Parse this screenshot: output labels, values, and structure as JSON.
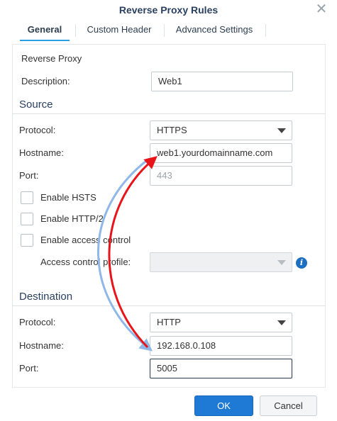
{
  "window": {
    "title": "Reverse Proxy Rules"
  },
  "tabs": [
    {
      "label": "General",
      "active": true
    },
    {
      "label": "Custom Header"
    },
    {
      "label": "Advanced Settings"
    }
  ],
  "general": {
    "heading": "Reverse Proxy",
    "description_label": "Description:",
    "description_value": "Web1"
  },
  "source": {
    "title": "Source",
    "protocol_label": "Protocol:",
    "protocol_value": "HTTPS",
    "hostname_label": "Hostname:",
    "hostname_value": "web1.yourdomainname.com",
    "port_label": "Port:",
    "port_value": "443",
    "hsts_label": "Enable HSTS",
    "http2_label": "Enable HTTP/2",
    "access_control_label": "Enable access control",
    "access_profile_label": "Access control profile:",
    "access_profile_value": ""
  },
  "destination": {
    "title": "Destination",
    "protocol_label": "Protocol:",
    "protocol_value": "HTTP",
    "hostname_label": "Hostname:",
    "hostname_value": "192.168.0.108",
    "port_label": "Port:",
    "port_value": "5005"
  },
  "footer": {
    "ok_label": "OK",
    "cancel_label": "Cancel"
  },
  "icons": {
    "close": "close-icon",
    "info": "info-icon",
    "dropdown": "chevron-down-icon"
  },
  "colors": {
    "accent": "#1f7ad6",
    "arrow_red": "#e8141a",
    "arrow_blue": "#8fb8e8",
    "title": "#2a4060"
  }
}
